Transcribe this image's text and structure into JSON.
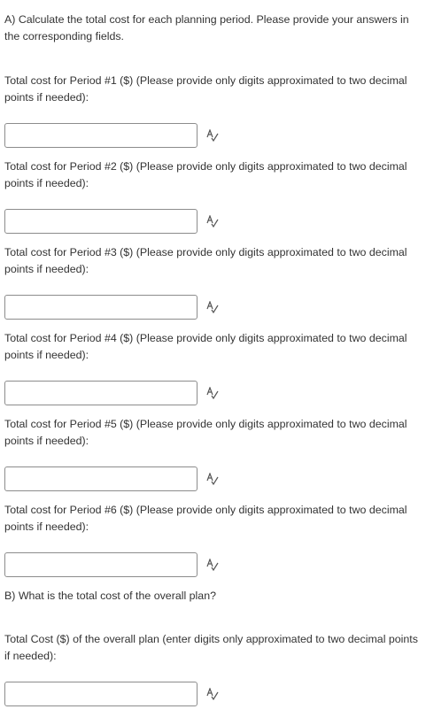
{
  "part_a": {
    "intro": "A) Calculate the total cost for each planning period. Please provide your answers in the corresponding fields.",
    "questions": [
      {
        "label": "Total cost for Period #1 ($) (Please provide only digits approximated to two decimal points if needed):",
        "value": ""
      },
      {
        "label": "Total cost for Period #2 ($) (Please provide only digits approximated to two decimal points if needed):",
        "value": ""
      },
      {
        "label": "Total cost for Period #3 ($) (Please provide only digits approximated to two decimal points if needed):",
        "value": ""
      },
      {
        "label": "Total cost for Period #4 ($) (Please provide only digits approximated to two decimal points if needed):",
        "value": ""
      },
      {
        "label": "Total cost for Period #5 ($) (Please provide only digits approximated to two decimal points if needed):",
        "value": ""
      },
      {
        "label": "Total cost for Period #6 ($) (Please provide only digits approximated to two decimal points if needed):",
        "value": ""
      }
    ]
  },
  "part_b": {
    "intro": "B) What is the total cost of the overall plan?",
    "question": {
      "label": "Total Cost ($) of the overall plan (enter digits only approximated to two decimal points if needed):",
      "value": ""
    }
  },
  "icons": {
    "spellcheck": "spell-check-icon"
  },
  "colors": {
    "text": "#333333",
    "field_border": "#8c8c8c",
    "background": "#ffffff"
  }
}
